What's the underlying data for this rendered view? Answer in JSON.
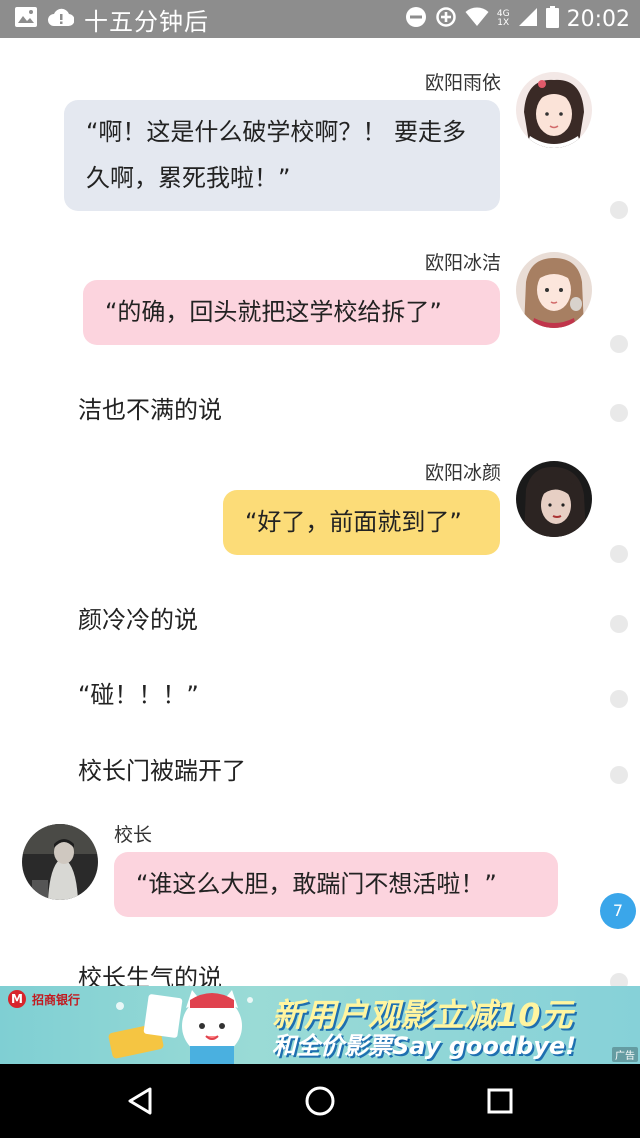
{
  "status_bar": {
    "title": "十五分钟后",
    "network_top": "4G",
    "network_bottom": "1X",
    "time": "20:02"
  },
  "messages": [
    {
      "type": "speech",
      "side": "right",
      "speaker": "欧阳雨依",
      "text": "“啊！这是什么破学校啊？！ 要走多久啊，累死我啦！”",
      "bubble_color": "#e4e8f0"
    },
    {
      "type": "speech",
      "side": "right",
      "speaker": "欧阳冰洁",
      "text": "“的确，回头就把这学校给拆了”",
      "bubble_color": "#fcd4de"
    },
    {
      "type": "narration",
      "text": "洁也不满的说"
    },
    {
      "type": "speech",
      "side": "right",
      "speaker": "欧阳冰颜",
      "text": "“好了，前面就到了”",
      "bubble_color": "#fcdc78"
    },
    {
      "type": "narration",
      "text": "颜冷冷的说"
    },
    {
      "type": "narration",
      "text": "“碰！！！”"
    },
    {
      "type": "narration",
      "text": "校长门被踹开了"
    },
    {
      "type": "speech",
      "side": "left",
      "speaker": "校长",
      "text": "“谁这么大胆，敢踹门不想活啦！”",
      "bubble_color": "#fcd4de"
    },
    {
      "type": "narration",
      "text": "校长生气的说"
    }
  ],
  "comment_badge": "7",
  "ad": {
    "bank_name": "招商银行",
    "line1": "新用户观影立减10元",
    "line2": "和全价影票Say goodbye!",
    "tag": "广告"
  },
  "colors": {
    "status_bar": "#8d8d8d",
    "badge": "#3aa6ea",
    "dot": "#e9e9e9",
    "nav_bar": "#000000"
  }
}
